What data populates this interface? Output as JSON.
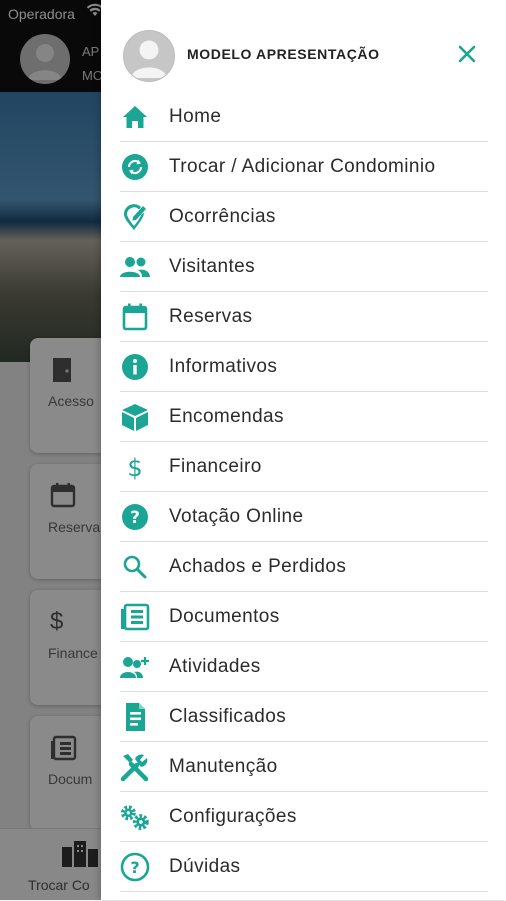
{
  "status_bar": {
    "carrier": "Operadora"
  },
  "background": {
    "user_line1": "AP",
    "user_line2": "MO",
    "cards": [
      {
        "label": "Acesso",
        "icon": "door-icon"
      },
      {
        "label": "Reserva",
        "icon": "calendar-icon"
      },
      {
        "label": "Finance",
        "icon": "dollar-icon"
      },
      {
        "label": "Docum",
        "icon": "document-icon"
      }
    ],
    "tab_label": "Trocar Co"
  },
  "drawer": {
    "user_name": "MODELO APRESENTAÇÃO",
    "accent_color": "#1aa594",
    "items": [
      {
        "label": "Home",
        "icon": "home-icon"
      },
      {
        "label": "Trocar / Adicionar Condominio",
        "icon": "swap-icon"
      },
      {
        "label": "Ocorrências",
        "icon": "map-pin-edit-icon"
      },
      {
        "label": "Visitantes",
        "icon": "people-icon"
      },
      {
        "label": "Reservas",
        "icon": "calendar-icon"
      },
      {
        "label": "Informativos",
        "icon": "info-icon"
      },
      {
        "label": "Encomendas",
        "icon": "package-icon"
      },
      {
        "label": "Financeiro",
        "icon": "dollar-icon"
      },
      {
        "label": "Votação Online",
        "icon": "help-circle-icon"
      },
      {
        "label": "Achados e Perdidos",
        "icon": "search-icon"
      },
      {
        "label": "Documentos",
        "icon": "document-icon"
      },
      {
        "label": "Atividades",
        "icon": "people-plus-icon"
      },
      {
        "label": "Classificados",
        "icon": "classified-icon"
      },
      {
        "label": "Manutenção",
        "icon": "wrench-icon"
      },
      {
        "label": "Configurações",
        "icon": "gears-icon"
      },
      {
        "label": "Dúvidas",
        "icon": "question-outline-icon"
      }
    ]
  }
}
